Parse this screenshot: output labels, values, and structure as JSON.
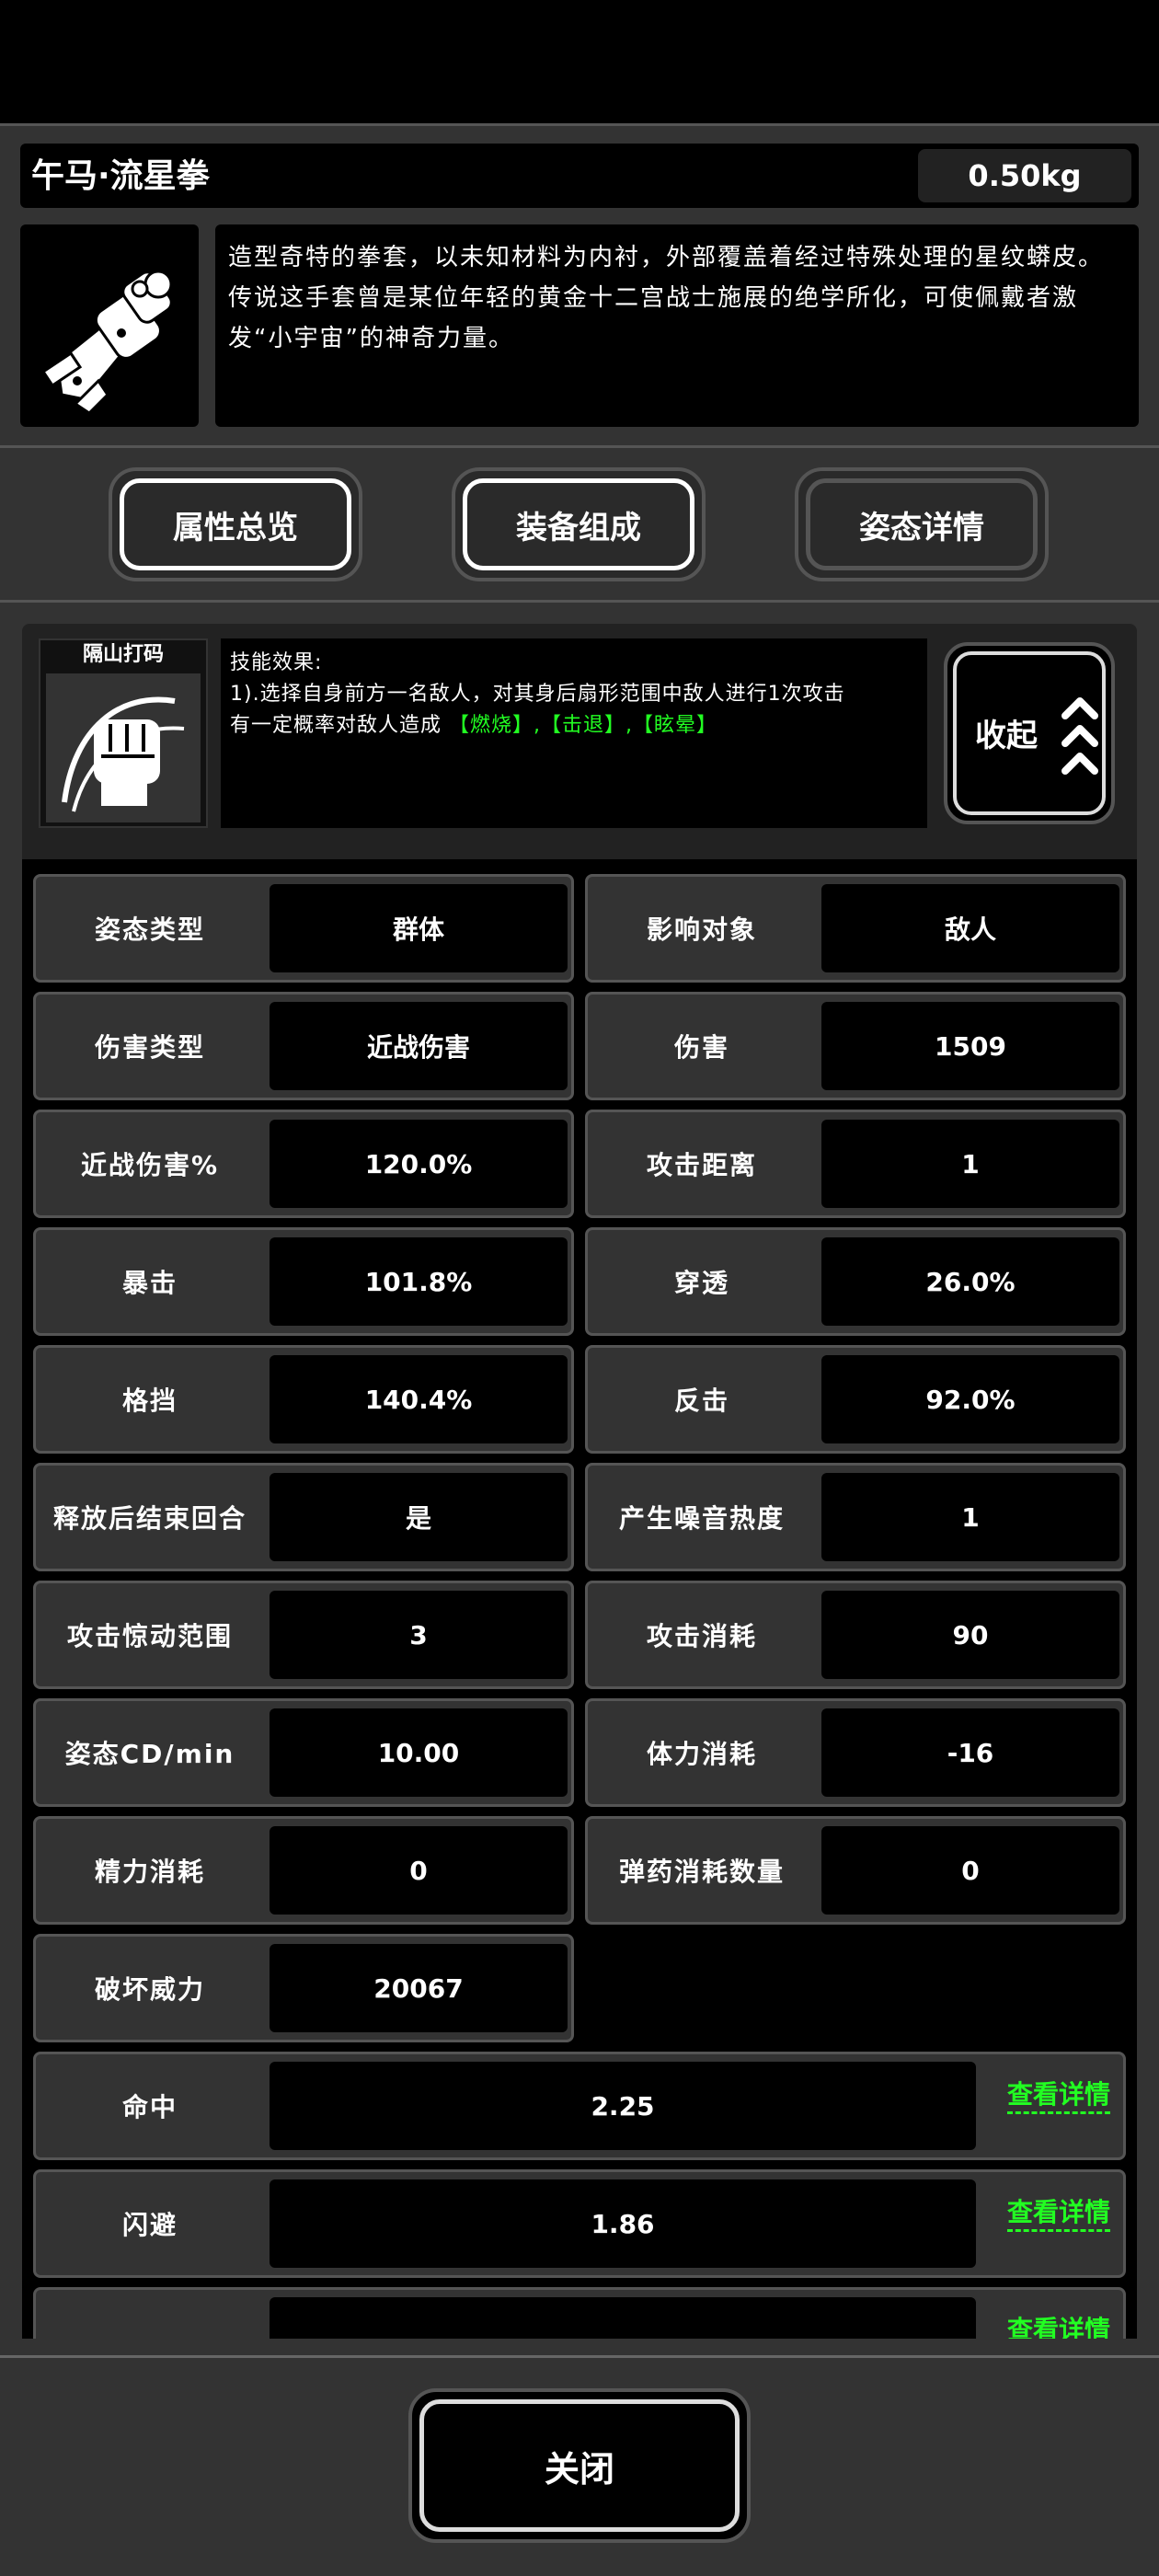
{
  "item": {
    "name": "午马·流星拳",
    "weight": "0.50kg",
    "description": "造型奇特的拳套，以未知材料为内衬，外部覆盖着经过特殊处理的星纹蟒皮。传说这手套曾是某位年轻的黄金十二宫战士施展的绝学所化，可使佩戴者激发“小宇宙”的神奇力量。"
  },
  "tabs": [
    {
      "label": "属性总览"
    },
    {
      "label": "装备组成"
    },
    {
      "label": "姿态详情"
    }
  ],
  "skill": {
    "name": "隔山打码",
    "effect_title": "技能效果:",
    "effect_line1": "1).选择自身前方一名敌人，对其身后扇形范围中敌人进行1次攻击",
    "effect_line2_prefix": "有一定概率对敌人造成",
    "effect_tags": "【燃烧】,【击退】,【眩晕】",
    "collapse_label": "收起"
  },
  "stats": [
    {
      "key": "姿态类型",
      "value": "群体"
    },
    {
      "key": "影响对象",
      "value": "敌人"
    },
    {
      "key": "伤害类型",
      "value": "近战伤害"
    },
    {
      "key": "伤害",
      "value": "1509"
    },
    {
      "key": "近战伤害%",
      "value": "120.0%"
    },
    {
      "key": "攻击距离",
      "value": "1"
    },
    {
      "key": "暴击",
      "value": "101.8%"
    },
    {
      "key": "穿透",
      "value": "26.0%"
    },
    {
      "key": "格挡",
      "value": "140.4%"
    },
    {
      "key": "反击",
      "value": "92.0%"
    },
    {
      "key": "释放后结束回合",
      "value": "是"
    },
    {
      "key": "产生噪音热度",
      "value": "1"
    },
    {
      "key": "攻击惊动范围",
      "value": "3"
    },
    {
      "key": "攻击消耗",
      "value": "90"
    },
    {
      "key": "姿态CD/min",
      "value": "10.00"
    },
    {
      "key": "体力消耗",
      "value": "-16"
    },
    {
      "key": "精力消耗",
      "value": "0"
    },
    {
      "key": "弹药消耗数量",
      "value": "0"
    },
    {
      "key": "破坏威力",
      "value": "20067"
    }
  ],
  "detail_rows": [
    {
      "key": "命中",
      "value": "2.25",
      "link": "查看详情"
    },
    {
      "key": "闪避",
      "value": "1.86",
      "link": "查看详情"
    },
    {
      "key": "",
      "value": "",
      "link": "查看详情"
    }
  ],
  "close_label": "关闭"
}
